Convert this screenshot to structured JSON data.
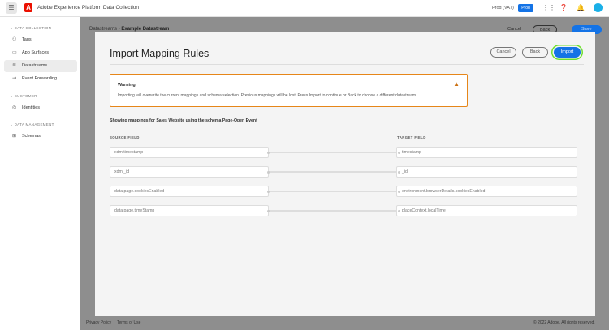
{
  "header": {
    "menu_icon": "hamburger-icon",
    "app_title": "Adobe Experience Platform Data Collection",
    "org": "Prod (VA7)",
    "env_badge": "Prod"
  },
  "sidebar": {
    "sections": [
      {
        "label": "DATA COLLECTION",
        "items": [
          {
            "label": "Tags"
          },
          {
            "label": "App Surfaces"
          },
          {
            "label": "Datastreams",
            "active": true
          },
          {
            "label": "Event Forwarding"
          }
        ]
      },
      {
        "label": "CUSTOMER",
        "items": [
          {
            "label": "Identities"
          }
        ]
      },
      {
        "label": "DATA MANAGEMENT",
        "items": [
          {
            "label": "Schemas"
          }
        ]
      }
    ]
  },
  "page": {
    "breadcrumb_parent": "Datastreams",
    "breadcrumb_current": "Example Datastream",
    "cancel": "Cancel",
    "back": "Back",
    "save": "Save",
    "privacy": "Privacy Policy",
    "terms": "Terms of Use",
    "copyright": "© 2022 Adobe. All rights reserved."
  },
  "modal": {
    "title": "Import Mapping Rules",
    "cancel": "Cancel",
    "back": "Back",
    "import": "Import",
    "warning_title": "Warning",
    "warning_text": "Importing will overwrite the current mappings and schema selection. Previous mappings will be lost. Press Import to continue or Back to choose a different datastream",
    "showing": "Showing mappings for Sales Website using the schema Page-Open Event",
    "source_header": "SOURCE FIELD",
    "target_header": "TARGET FIELD",
    "mappings": [
      {
        "source": "xdm.timestamp",
        "target": "timestamp"
      },
      {
        "source": "xdm._id",
        "target": "_id"
      },
      {
        "source": "data.page.cookiesEnabled",
        "target": "environment.browserDetails.cookiesEnabled"
      },
      {
        "source": "data.page.timeStamp",
        "target": "placeContext.localTime"
      }
    ]
  },
  "colors": {
    "accent": "#1473e6",
    "warning": "#e68619",
    "focus": "#6ee02c"
  }
}
